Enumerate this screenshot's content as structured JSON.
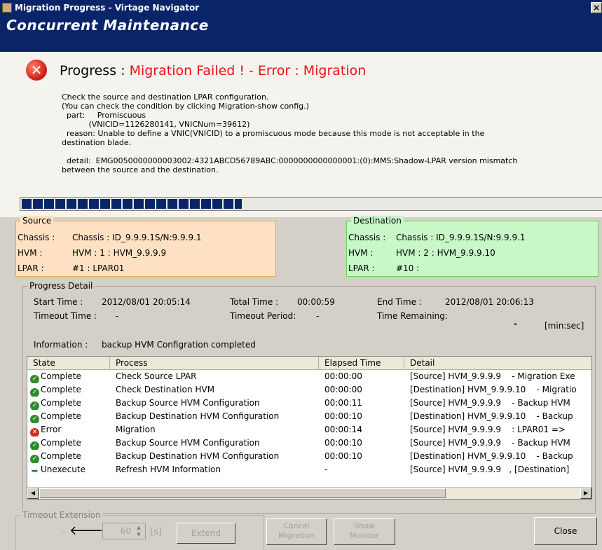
{
  "window": {
    "title": "Migration Progress - Virtage Navigator",
    "close": "×"
  },
  "header": {
    "title": "Concurrent Maintenance"
  },
  "progress": {
    "label": "Progress :",
    "status": "Migration Failed ! - Error : Migration",
    "bar_fraction": 0.38
  },
  "message": {
    "lines": [
      "Check the source and destination LPAR configuration.",
      "(You can check the condition by clicking Migration-show config.)",
      "  part:     Promiscuous",
      "           (VNICID=1126280141, VNICNum=39612)",
      "  reason: Unable to define a VNIC(VNICID) to a promiscuous mode because this mode is not acceptable in the",
      "destination blade.",
      "",
      "  detail:  EMG0050000000003002:4321ABCD56789ABC:0000000000000001:(0):MMS:Shadow-LPAR version mismatch",
      "between the source and the destination."
    ]
  },
  "source": {
    "legend": "Source",
    "chassis_label": "Chassis :",
    "chassis": "Chassis : ID_9.9.9.1S/N:9.9.9.1",
    "hvm_label": "HVM :",
    "hvm": "HVM : 1 : HVM_9.9.9.9",
    "lpar_label": "LPAR :",
    "lpar": "#1 : LPAR01"
  },
  "destination": {
    "legend": "Destination",
    "chassis_label": "Chassis :",
    "chassis": "Chassis : ID_9.9.9.1S/N:9.9.9.1",
    "hvm_label": "HVM :",
    "hvm": "HVM : 2 : HVM_9.9.9.10",
    "lpar_label": "LPAR :",
    "lpar": "#10 :"
  },
  "detail": {
    "legend": "Progress Detail",
    "start_label": "Start Time :",
    "start": "2012/08/01 20:05:14",
    "total_label": "Total Time :",
    "total": "00:00:59",
    "end_label": "End Time :",
    "end": "2012/08/01 20:06:13",
    "timeout_label": "Timeout Time :",
    "timeout": "-",
    "period_label": "Timeout Period:",
    "period": "-",
    "remaining_label": "Time Remaining:",
    "remaining": "-",
    "unit": "[min:sec]",
    "info_label": "Information :",
    "info": "backup HVM Configration completed"
  },
  "table": {
    "headers": [
      "State",
      "Process",
      "Elapsed Time",
      "Detail"
    ],
    "rows": [
      {
        "icon": "ok",
        "state": "Complete",
        "process": "Check Source LPAR",
        "elapsed": "00:00:00",
        "detail": "[Source] HVM_9.9.9.9    - Migration Exe"
      },
      {
        "icon": "ok",
        "state": "Complete",
        "process": "Check Destination HVM",
        "elapsed": "00:00:00",
        "detail": "[Destination] HVM_9.9.9.10    - Migratio"
      },
      {
        "icon": "ok",
        "state": "Complete",
        "process": "Backup Source HVM Configuration",
        "elapsed": "00:00:11",
        "detail": "[Source] HVM_9.9.9.9    - Backup HVM"
      },
      {
        "icon": "ok",
        "state": "Complete",
        "process": "Backup Destination HVM Configuration",
        "elapsed": "00:00:10",
        "detail": "[Destination] HVM_9.9.9.10    - Backup"
      },
      {
        "icon": "error",
        "state": "Error",
        "process": "Migration",
        "elapsed": "00:00:14",
        "detail": "[Source] HVM_9.9.9.9    : LPAR01 =>"
      },
      {
        "icon": "ok",
        "state": "Complete",
        "process": "Backup Source HVM Configuration",
        "elapsed": "00:00:10",
        "detail": "[Source] HVM_9.9.9.9    - Backup HVM"
      },
      {
        "icon": "ok",
        "state": "Complete",
        "process": "Backup Destination HVM Configuration",
        "elapsed": "00:00:10",
        "detail": "[Destination] HVM_9.9.9.10    - Backup"
      },
      {
        "icon": "pending",
        "state": "Unexecute",
        "process": "Refresh HVM Information",
        "elapsed": "-",
        "detail": "[Source] HVM_9.9.9.9   , [Destination]"
      }
    ]
  },
  "timeout_ext": {
    "legend": "Timeout Extension",
    "dash": "-",
    "value": "60",
    "unit": "[s]",
    "extend": "Extend"
  },
  "buttons": {
    "cancel": "Cancel\nMigration",
    "show": "Show\nMonitor",
    "close": "Close"
  },
  "colors": {
    "title_bg": "#0a246a",
    "error_red": "#e11111",
    "source_bg": "#fde1c2",
    "dest_bg": "#c8f7c8"
  }
}
